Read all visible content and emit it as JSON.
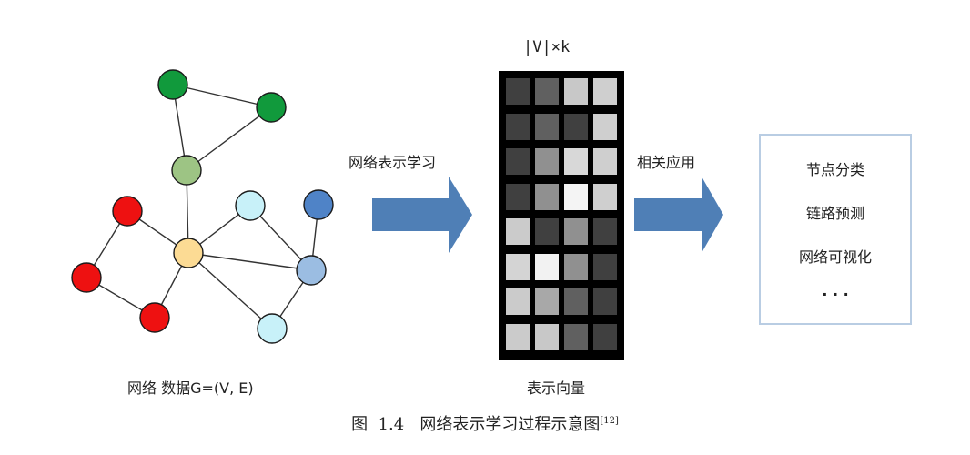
{
  "graph": {
    "label": "网络 数据G=(V, E)",
    "nodes": [
      {
        "id": "g1",
        "color": "#119a3c"
      },
      {
        "id": "g2",
        "color": "#119a3c"
      },
      {
        "id": "c1",
        "color": "#9dc484"
      },
      {
        "id": "y1",
        "color": "#fcdb94"
      },
      {
        "id": "r1",
        "color": "#ee1111"
      },
      {
        "id": "r2",
        "color": "#ee1111"
      },
      {
        "id": "r3",
        "color": "#ee1111"
      },
      {
        "id": "l1",
        "color": "#c8f1f9"
      },
      {
        "id": "l2",
        "color": "#c8f1f9"
      },
      {
        "id": "b1",
        "color": "#4f83c7"
      },
      {
        "id": "b2",
        "color": "#9bbde2"
      }
    ],
    "edges": [
      [
        "g1",
        "g2"
      ],
      [
        "g1",
        "c1"
      ],
      [
        "g2",
        "c1"
      ],
      [
        "c1",
        "y1"
      ],
      [
        "r1",
        "y1"
      ],
      [
        "r1",
        "r2"
      ],
      [
        "r2",
        "r3"
      ],
      [
        "r3",
        "y1"
      ],
      [
        "y1",
        "l1"
      ],
      [
        "y1",
        "b2"
      ],
      [
        "y1",
        "l2"
      ],
      [
        "l1",
        "b2"
      ],
      [
        "b1",
        "b2"
      ],
      [
        "b2",
        "l2"
      ]
    ]
  },
  "arrow1_label": "网络表示学习",
  "arrow2_label": "相关应用",
  "matrix": {
    "top_label": "|V|×k",
    "bottom_label": "表示向量",
    "cells": [
      [
        "#404040",
        "#606060",
        "#c8c8c8",
        "#cfcfcf"
      ],
      [
        "#404040",
        "#606060",
        "#404040",
        "#cfcfcf"
      ],
      [
        "#404040",
        "#909090",
        "#d8d8d8",
        "#cfcfcf"
      ],
      [
        "#404040",
        "#909090",
        "#f4f4f4",
        "#cfcfcf"
      ],
      [
        "#cbcbcb",
        "#404040",
        "#909090",
        "#404040"
      ],
      [
        "#d4d4d4",
        "#f2f2f2",
        "#909090",
        "#404040"
      ],
      [
        "#cbcbcb",
        "#a8a8a8",
        "#606060",
        "#404040"
      ],
      [
        "#cbcbcb",
        "#c8c8c8",
        "#606060",
        "#404040"
      ]
    ]
  },
  "applications": {
    "items": [
      "节点分类",
      "链路预测",
      "网络可视化",
      "· · ·"
    ]
  },
  "caption": {
    "text": "图  1.4   网络表示学习过程示意图",
    "ref": "[12]"
  },
  "colors": {
    "arrow": "#4f7fb6",
    "box_border": "#b9cde3",
    "node_stroke": "#1a1a1a"
  }
}
